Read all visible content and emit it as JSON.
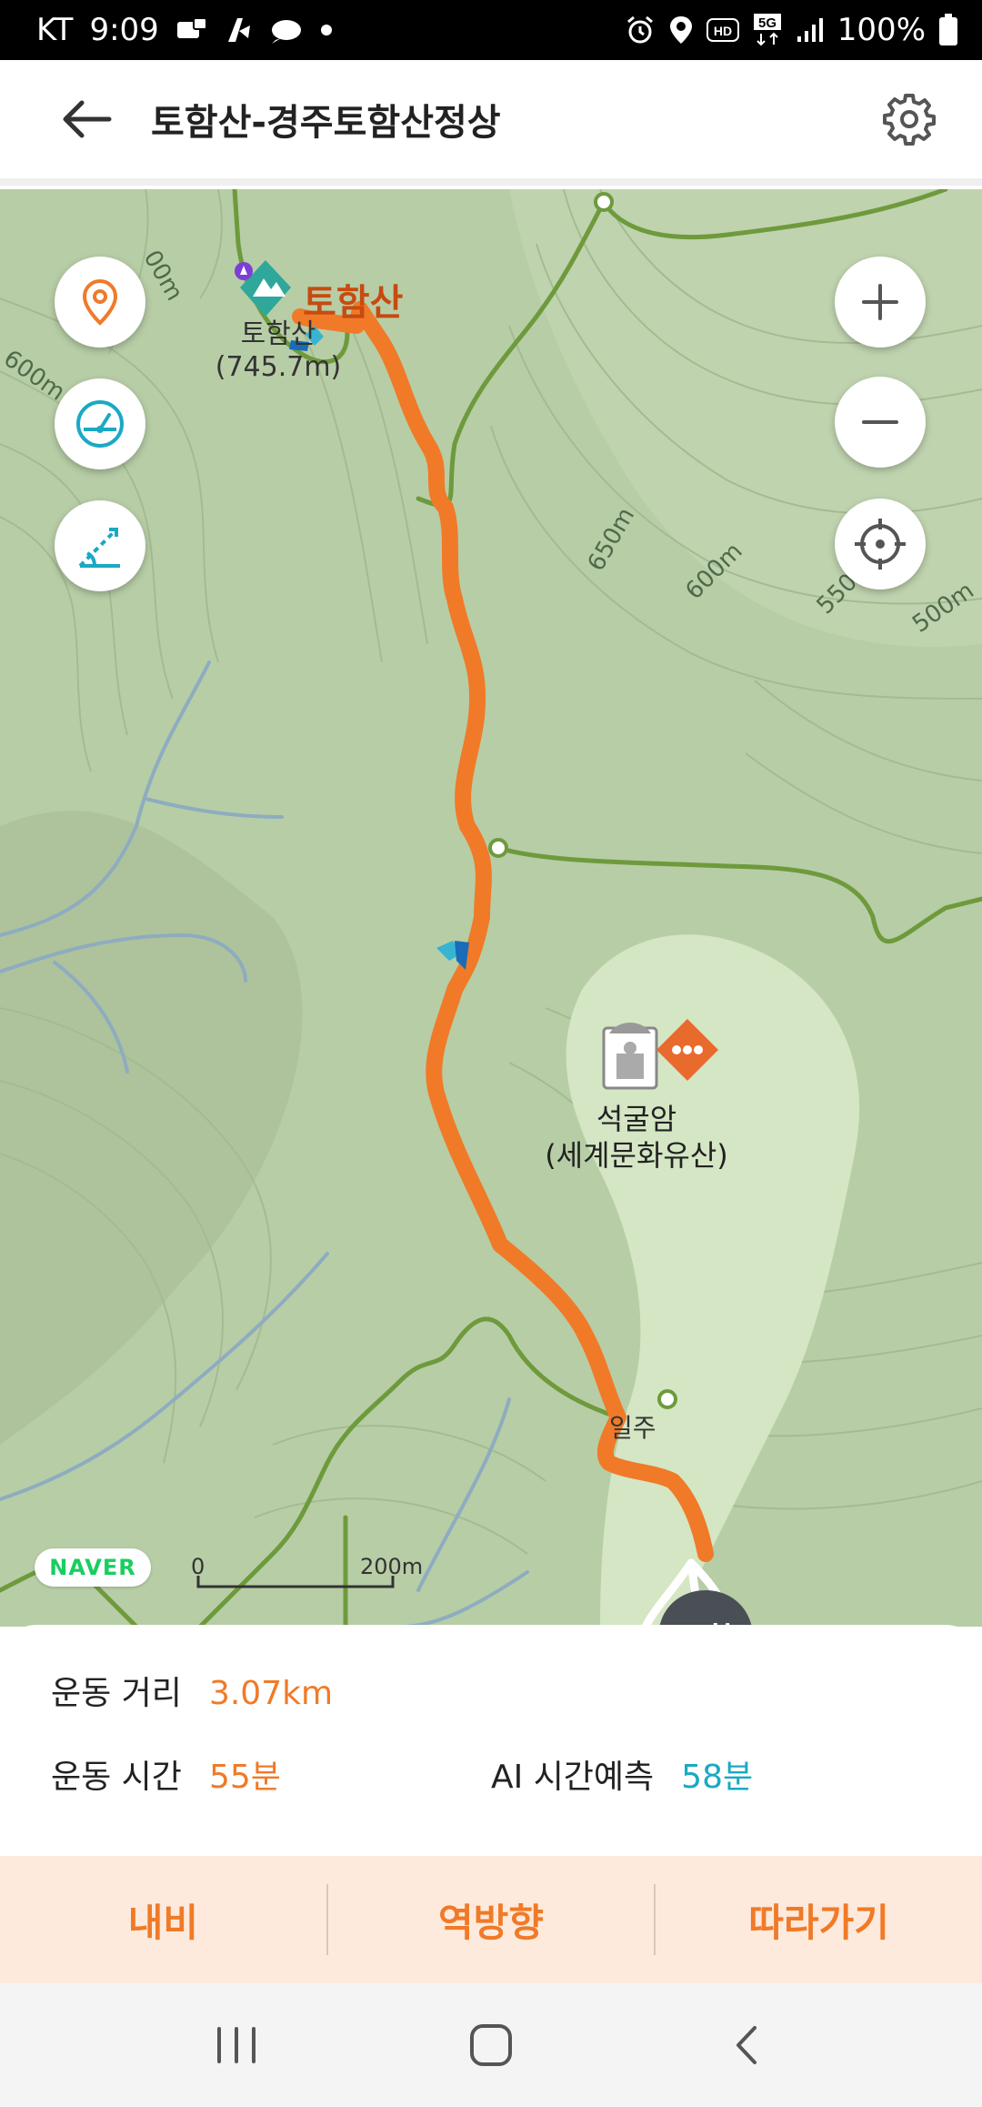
{
  "status_bar": {
    "carrier": "KT",
    "time": "9:09",
    "battery": "100%",
    "left_icons": [
      "notification-icon",
      "notification-icon",
      "cloud-icon",
      "dot-icon"
    ],
    "right_icons": [
      "alarm-icon",
      "location-icon",
      "hd-icon",
      "5g-icon",
      "signal-icon",
      "battery-icon"
    ]
  },
  "app_bar": {
    "title": "토함산-경주토함산정상"
  },
  "map": {
    "peak_name": "토함산",
    "peak_label_line1": "토함산",
    "peak_label_line2": "(745.7m)",
    "poi_line1": "석굴암",
    "poi_line2": "(세계문화유산)",
    "partial_label": "일주",
    "arrive_label": "도착",
    "naver": "NAVER",
    "scale_start": "0",
    "scale_end": "200m",
    "contours": [
      "600m",
      "650m",
      "600m",
      "550",
      "500m",
      "600m",
      "00m"
    ],
    "route_color": "#f07a28",
    "controls": [
      "location-pin-icon",
      "speedometer-icon",
      "slope-icon",
      "zoom-in-icon",
      "zoom-out-icon",
      "crosshair-icon"
    ]
  },
  "stats": {
    "distance_label": "운동 거리",
    "distance_value": "3.07km",
    "time_label": "운동 시간",
    "time_value": "55분",
    "ai_label": "AI 시간예측",
    "ai_value": "58분"
  },
  "actions": {
    "nav": "내비",
    "reverse": "역방향",
    "follow": "따라가기"
  }
}
